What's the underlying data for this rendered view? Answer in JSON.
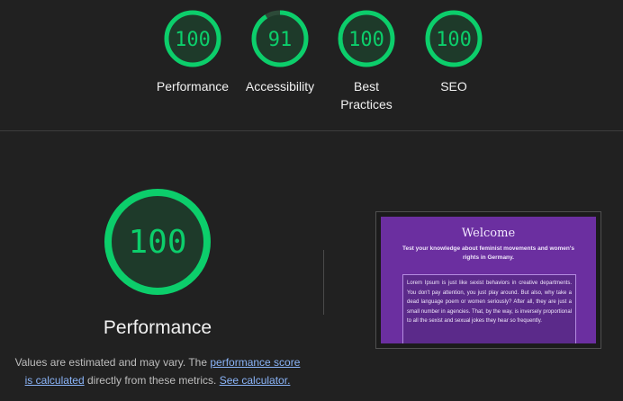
{
  "summary_gauges": [
    {
      "score": "100",
      "label": "Performance",
      "fraction": 1.0
    },
    {
      "score": "91",
      "label": "Accessibility",
      "fraction": 0.91
    },
    {
      "score": "100",
      "label": "Best Practices",
      "fraction": 1.0
    },
    {
      "score": "100",
      "label": "SEO",
      "fraction": 1.0
    }
  ],
  "performance": {
    "score": "100",
    "fraction": 1.0,
    "title": "Performance",
    "note_prefix": "Values are estimated and may vary. The ",
    "note_link1": "performance score is calculated",
    "note_middle": " directly from these metrics. ",
    "note_link2": "See calculator."
  },
  "screenshot": {
    "title": "Welcome",
    "subtitle": "Test your knowledge about feminist movements and women's rights in Germany.",
    "body": "Lorem Ipsum is just like sexist behaviors in creative departments. You don't pay attention, you just play around. But also, why take a dead language poem or women seriously? After all, they are just a small number in agencies. That, by the way, is inversely proportional to all the sexist and sexual jokes they hear so frequently."
  },
  "colors": {
    "pass": "#0cce6b",
    "pass_fill": "#1e3a2a",
    "background": "#212121",
    "link": "#8ab4f8",
    "thumb_purple": "#6b2fa0"
  }
}
